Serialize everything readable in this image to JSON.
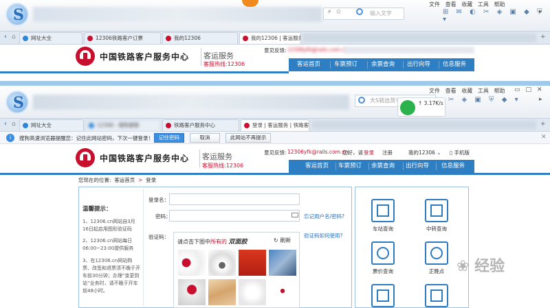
{
  "browser_top": {
    "menu": [
      "文件",
      "查看",
      "收藏",
      "工具",
      "帮助"
    ],
    "search_placeholder": "输入文字",
    "tabs": [
      {
        "label": "网址大全"
      },
      {
        "label": "12306铁路客户订票"
      },
      {
        "label": "我的12306"
      },
      {
        "label": "我的12306 | 客运服务"
      }
    ]
  },
  "site_top": {
    "brand": "中国铁路客户服务中心",
    "service": "客运服务",
    "hotline": "客服热线:12306",
    "feedback_label": "意见反馈:",
    "feedback_email": "12306yfk@rails.com.cn",
    "nav": [
      "客运首页",
      "车票预订",
      "余票查询",
      "出行向导",
      "信息服务"
    ]
  },
  "browser": {
    "menu": [
      "文件",
      "查看",
      "收藏",
      "工具",
      "帮助"
    ],
    "search_placeholder": "大S就出货不用...",
    "net_speed": "3.17K/s",
    "tabs": [
      {
        "label": "网址大全"
      },
      {
        "label": "12306 - 搜狗搜索"
      },
      {
        "label": "铁路客户服务中心"
      },
      {
        "label": "登录 | 客运服务 | 铁路客户"
      }
    ]
  },
  "password_notice": {
    "text": "搜狗高速浏览器提醒您：记住此网站密码，下次一键登录！",
    "remember_button": "记住密码",
    "cancel_button": "取消",
    "never_button": "此网站不再提示"
  },
  "site": {
    "brand": "中国铁路客户服务中心",
    "service": "客运服务",
    "hotline": "客服热线:12306",
    "feedback_label": "意见反馈:",
    "feedback_email": "12306yfk@rails.com.cn",
    "greeting": "您好，请",
    "login_link": "登录",
    "register_link": "注册",
    "my12306": "我的12306",
    "mobile": "手机版",
    "nav": [
      "客运首页",
      "车票预订",
      "余票查询",
      "出行向导",
      "信息服务"
    ]
  },
  "breadcrumb": {
    "prefix": "您现在的位置:",
    "home": "客运首页",
    "current": "登录"
  },
  "tips": {
    "title": "温馨提示：",
    "items": [
      "1、12306.cn网站自3月16日起启用图形验证码",
      "2、12306.cn网站每日06:00~23:00提供服务",
      "3、在12306.cn网站购票、改签和退票须不晚于开车前30分钟；办理“变更到站”业务时，请不晚于开车前48小时。"
    ]
  },
  "login_form": {
    "username_label": "登录名：",
    "password_label": "密码：",
    "captcha_label": "验证码：",
    "forgot_link": "忘记用户名/密码?",
    "captcha_help": "验证码如何使用?",
    "captcha_prompt_pre": "请点击下图中",
    "captcha_prompt_emph": "所有的",
    "captcha_prompt_target": "双面胶",
    "refresh": "刷新"
  },
  "quick_links": [
    {
      "label": "车站查询",
      "icon": "station-icon"
    },
    {
      "label": "中转查询",
      "icon": "transfer-icon"
    },
    {
      "label": "票价查询",
      "icon": "fare-icon"
    },
    {
      "label": "正晚点",
      "icon": "clock-icon"
    },
    {
      "label": "",
      "icon": "ticket-icon"
    },
    {
      "label": "",
      "icon": "train-icon"
    }
  ],
  "watermark": "经验"
}
